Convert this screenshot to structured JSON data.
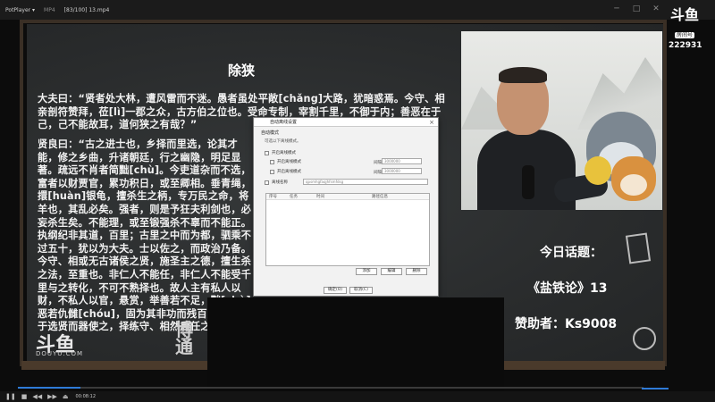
{
  "player": {
    "app_name": "PotPlayer ▾",
    "segment": "MP4",
    "file_name": "[83/100] 13.mp4",
    "window_buttons": [
      "─",
      "□",
      "✕"
    ],
    "timecode": "00:08:12",
    "progress_fraction": 0.1,
    "controls": [
      "❚❚",
      "■",
      "◀◀",
      "▶▶",
      "⏏"
    ]
  },
  "board": {
    "title": "除狭",
    "para1": "大夫曰：“贤者处大林，遭风雷而不迷。愚者虽处平敞[chǎng]大路，犹暗惑焉。今守、相亲剖符赞拜，莅[lì]一郡之众，古方伯之位也。受命专制，宰割千里，不御于内；善恶在于己，己不能故耳，道何狭之有哉？”",
    "para2": "贤良曰：“古之进士也，乡择而里选，论其才能，修之乡曲，升诸朝廷，行之幽隐，明足显著。疏远不肖者简黜[chù]。今吏道杂而不选，富者以财贾官，累功积日，或至卿相。垂青绳，擐[huàn]银龟，擅杀生之柄，专万民之命，将羊也，其乱必矣。强者，则是予狂夫利剑也，必妄杀生矣。不能理，或至锻强杀不辜而不能正。执纲纪非其道，百里；古里之中而为都，驷乘不过五十，犹以为大夫。士以佐之，而政治乃备。今守、相或无古诸侯之贤，施圣主之德，擅生杀之法，至重也。非仁人不能任，非仁人不能受千里与之转化，不可不熟择也。故人主有私人以财，不私人以官，悬赏，举善若不足，黜[chù]恶若仇雠[chóu]，固为其非功而残百姓也，在于选贤而器使之，择练守、相然后任之。”",
    "logo": "斗鱼",
    "logo_sub": "DOUYU.COM",
    "stamp": "博\n通"
  },
  "side": {
    "topic": "今日话题：",
    "book": "《盐铁论》13",
    "sponsor": "赞助者：Ks9008"
  },
  "corner": {
    "brand": "斗鱼",
    "tag": "房间号",
    "room_id": "222931"
  },
  "dialog": {
    "title": "自动离线设置",
    "section": "自动模式",
    "desc": "可选以下离线模式。",
    "check_main": "开启离线模式",
    "check_a": "开启离线模式",
    "check_b": "开启离线模式",
    "check_c": "离线名称",
    "label_interval": "间隔",
    "label_interval2": "间隔",
    "input_interval": "3000000",
    "input_interval2": "3000000",
    "input_name": "qpsmhgfaqjhfsmfdsg",
    "columns": [
      "序号",
      "任务",
      "时间",
      "路径信息"
    ],
    "btn_add": "添加",
    "btn_edit": "编辑",
    "btn_delete": "删除",
    "btn_ok": "确定(O)",
    "btn_cancel": "取消(C)"
  },
  "colors": {
    "board": "#2b2e2f",
    "progress": "#2f7bd8"
  }
}
